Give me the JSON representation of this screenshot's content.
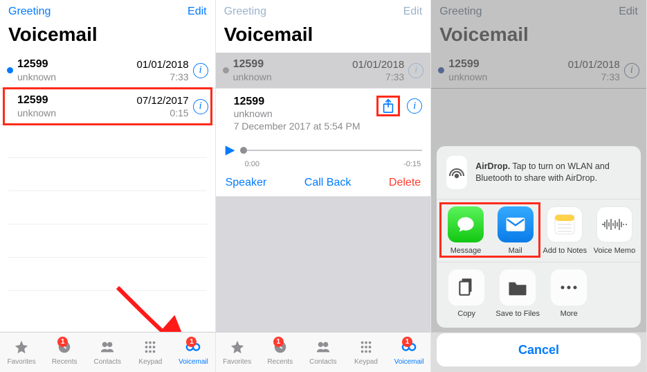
{
  "nav": {
    "greeting": "Greeting",
    "edit": "Edit",
    "title": "Voicemail"
  },
  "list": [
    {
      "num": "12599",
      "sub": "unknown",
      "date": "01/01/2018",
      "time": "7:33",
      "unread": true
    },
    {
      "num": "12599",
      "sub": "unknown",
      "date": "07/12/2017",
      "time": "0:15",
      "unread": false
    }
  ],
  "expanded": {
    "num": "12599",
    "sub": "unknown",
    "stamp": "7 December 2017 at 5:54 PM",
    "elapsed": "0:00",
    "remaining": "-0:15",
    "speaker": "Speaker",
    "callback": "Call Back",
    "delete": "Delete"
  },
  "tabs": {
    "favorites": "Favorites",
    "recents": "Recents",
    "contacts": "Contacts",
    "keypad": "Keypad",
    "voicemail": "Voicemail",
    "recents_badge": "1",
    "voicemail_badge": "1"
  },
  "share": {
    "airdrop_bold": "AirDrop.",
    "airdrop_text": " Tap to turn on WLAN and Bluetooth to share with AirDrop.",
    "apps": [
      "Message",
      "Mail",
      "Add to Notes",
      "Voice Memo"
    ],
    "actions": [
      "Copy",
      "Save to Files",
      "More"
    ],
    "cancel": "Cancel"
  }
}
